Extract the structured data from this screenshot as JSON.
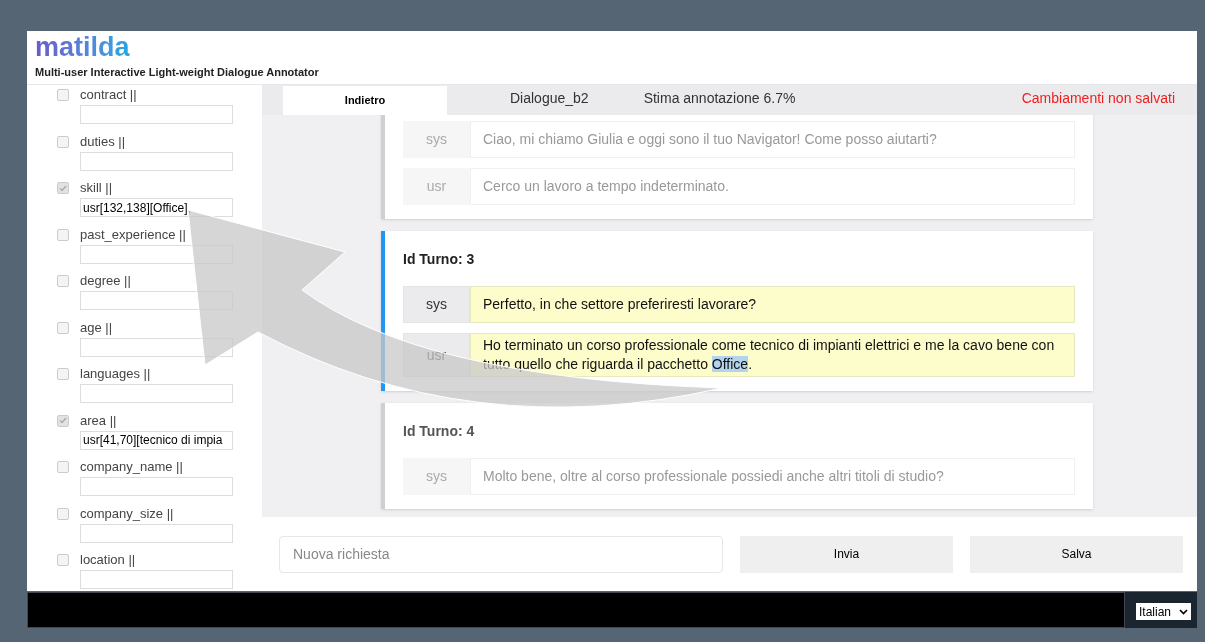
{
  "logo": {
    "name": "matilda",
    "subtitle": "Multi-user Interactive Light-weight Dialogue Annotator"
  },
  "slots": [
    {
      "label": "contract ||",
      "checked": false
    },
    {
      "label": "duties ||",
      "checked": false
    },
    {
      "label": "skill ||",
      "value": "usr[132,138][Office],",
      "checked": true
    },
    {
      "label": "past_experience ||",
      "checked": false
    },
    {
      "label": "degree ||",
      "checked": false
    },
    {
      "label": "age ||",
      "checked": false
    },
    {
      "label": "languages ||",
      "checked": false
    },
    {
      "label": "area ||",
      "value": "usr[41,70][tecnico di impia",
      "checked": true
    },
    {
      "label": "company_name ||",
      "checked": false
    },
    {
      "label": "company_size ||",
      "checked": false
    },
    {
      "label": "location ||",
      "checked": false
    }
  ],
  "top_bar": {
    "back_tab": "Indietro",
    "dialogue": "Dialogue_b2",
    "estimate": "Stima annotazione 6.7%",
    "unsaved": "Cambiamenti non salvati"
  },
  "turns": [
    {
      "selected": false,
      "messages": [
        {
          "speaker": "sys",
          "segments": [
            {
              "kind": "plain",
              "text": "Ciao, mi chiamo Giulia e oggi sono il tuo Navigator! Come posso aiutarti?"
            }
          ]
        },
        {
          "speaker": "usr",
          "segments": [
            {
              "kind": "plain",
              "text": "Cerco un lavoro a tempo indeterminato."
            }
          ]
        }
      ]
    },
    {
      "title": "Id Turno: 3",
      "selected": true,
      "messages": [
        {
          "speaker": "sys",
          "segments": [
            {
              "kind": "plain",
              "text": "Perfetto, in che settore preferiresti lavorare?"
            }
          ]
        },
        {
          "speaker": "usr",
          "segments": [
            {
              "kind": "plain",
              "text": "Ho terminato un corso professionale come tecnico di impianti elettrici e me la cavo bene con tutto quello che riguarda il pacchetto "
            },
            {
              "kind": "highlight",
              "text": "Office"
            },
            {
              "kind": "plain",
              "text": "."
            }
          ]
        }
      ]
    },
    {
      "title": "Id Turno: 4",
      "selected": false,
      "messages": [
        {
          "speaker": "sys",
          "segments": [
            {
              "kind": "plain",
              "text": "Molto bene, oltre al corso professionale possiedi anche altri titoli di studio?"
            }
          ]
        }
      ]
    }
  ],
  "input": {
    "placeholder": "Nuova richiesta"
  },
  "buttons": [
    "Invia",
    "Salva"
  ],
  "language_select": {
    "value": "Italian"
  }
}
